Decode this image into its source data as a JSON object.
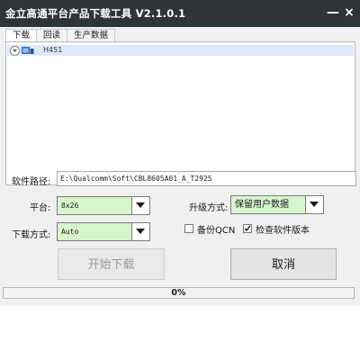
{
  "window": {
    "title": "金立高通平台产品下载工具 V2.1.0.1",
    "minimize_symbol": "—",
    "close_symbol": "×"
  },
  "tabs": [
    {
      "label": "下载",
      "active": true
    },
    {
      "label": "回读",
      "active": false
    },
    {
      "label": "生产数据",
      "active": false
    }
  ],
  "device_list": [
    {
      "label": "H451",
      "expanded": false
    }
  ],
  "form": {
    "path_label": "软件路径:",
    "path_value": "E:\\Qualcomm\\Soft\\CBL8605A01_A_T2925",
    "platform_label": "平台:",
    "platform_value": "8x26",
    "upgrade_label": "升级方式:",
    "upgrade_value": "保留用户数据",
    "download_mode_label": "下载方式:",
    "download_mode_value": "Auto",
    "backup_qcn_label": "备份QCN",
    "backup_qcn_checked": false,
    "check_version_label": "检查软件版本",
    "check_version_checked": true
  },
  "buttons": {
    "start_label": "开始下载",
    "cancel_label": "取消"
  },
  "progress": {
    "value": 0,
    "text": "0%"
  },
  "colors": {
    "titlebar": "#2e3438",
    "combo_bg": "#d6f5cc",
    "selection": "#dce9fb"
  }
}
